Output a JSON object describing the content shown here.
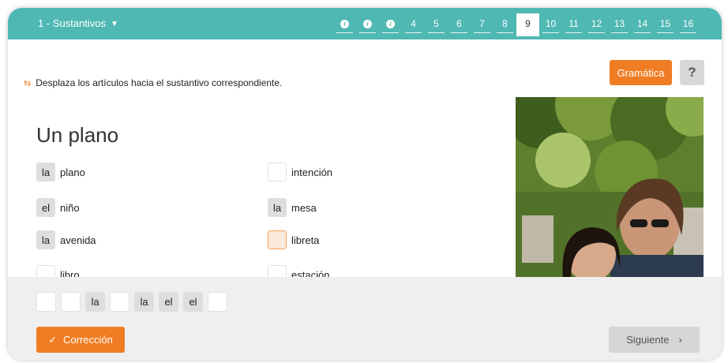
{
  "topbar": {
    "unit_label": "1 - Sustantivos",
    "pages": [
      {
        "label": "i",
        "state": "done"
      },
      {
        "label": "i",
        "state": "done"
      },
      {
        "label": "i",
        "state": "done"
      },
      {
        "label": "4",
        "state": "todo"
      },
      {
        "label": "5",
        "state": "todo"
      },
      {
        "label": "6",
        "state": "todo"
      },
      {
        "label": "7",
        "state": "todo"
      },
      {
        "label": "8",
        "state": "todo"
      },
      {
        "label": "9",
        "state": "active"
      },
      {
        "label": "10",
        "state": "todo"
      },
      {
        "label": "11",
        "state": "todo"
      },
      {
        "label": "12",
        "state": "todo"
      },
      {
        "label": "13",
        "state": "todo"
      },
      {
        "label": "14",
        "state": "todo"
      },
      {
        "label": "15",
        "state": "todo"
      },
      {
        "label": "16",
        "state": "todo"
      }
    ]
  },
  "buttons": {
    "grammar": "Gramática",
    "help": "?",
    "correction": "Corrección",
    "next": "Siguiente",
    "next_chevron": "›",
    "check": "✓"
  },
  "instruction": "Desplaza los artículos hacia el sustantivo correspondiente.",
  "example_title": "Un plano",
  "items": [
    {
      "article": "la",
      "noun": "plano",
      "state": "filled"
    },
    {
      "article": "",
      "noun": "intención",
      "state": "empty"
    },
    {
      "article": "el",
      "noun": "niño",
      "state": "filled"
    },
    {
      "article": "la",
      "noun": "mesa",
      "state": "filled"
    },
    {
      "article": "la",
      "noun": "avenida",
      "state": "filled"
    },
    {
      "article": "",
      "noun": "libreta",
      "state": "highlight"
    },
    {
      "article": "",
      "noun": "libro",
      "state": "empty"
    },
    {
      "article": "",
      "noun": "estación",
      "state": "empty"
    }
  ],
  "tray": [
    "",
    "",
    "la",
    "",
    "la",
    "el",
    "el",
    ""
  ],
  "colors": {
    "topbar": "#4fb8b3",
    "accent": "#f07d23",
    "bottom": "#efefef"
  }
}
